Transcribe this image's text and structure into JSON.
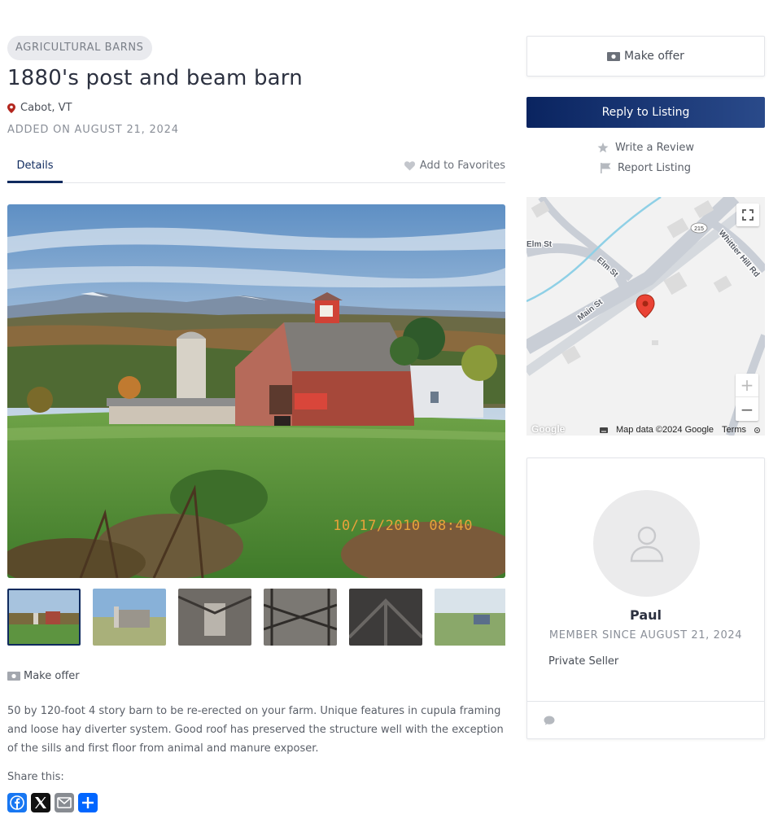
{
  "listing": {
    "category": "AGRICULTURAL BARNS",
    "title": "1880's post and beam barn",
    "location": "Cabot, VT",
    "added": "ADDED ON AUGUST 21, 2024",
    "photo_timestamp": "10/17/2010 08:40",
    "description": "50 by 120-foot 4 story barn to be re-erected on your farm. Unique features in cupula framing and loose hay diverter system. Good roof has preserved the structure well with the exception of the sills and first floor from animal and manure exposer.",
    "thumbnail_count": 6,
    "active_thumbnail": 1
  },
  "tabs": {
    "details_label": "Details",
    "favorites_label": "Add to Favorites"
  },
  "actions": {
    "make_offer_label": "Make offer",
    "reply_label": "Reply to Listing",
    "write_review_label": "Write a Review",
    "report_label": "Report Listing"
  },
  "share": {
    "label": "Share this:",
    "buttons": [
      "facebook-icon",
      "x-icon",
      "email-icon",
      "share-plus-icon"
    ]
  },
  "map": {
    "streets": [
      "Elm St",
      "Elm St",
      "Main St",
      "Whittier Hill Rd"
    ],
    "route_shield": "215",
    "attribution": "Map data ©2024 Google",
    "terms_label": "Terms",
    "logo_text": "Google",
    "zoom_in_label": "+",
    "zoom_out_label": "−"
  },
  "seller": {
    "name": "Paul",
    "member_since": "MEMBER SINCE AUGUST 21, 2024",
    "type": "Private Seller"
  },
  "colors": {
    "primary": "#0f2a5e",
    "pin_red": "#b3261e",
    "muted_text": "#8a8f98",
    "facebook": "#1877f2",
    "share_blue": "#0166ff"
  }
}
